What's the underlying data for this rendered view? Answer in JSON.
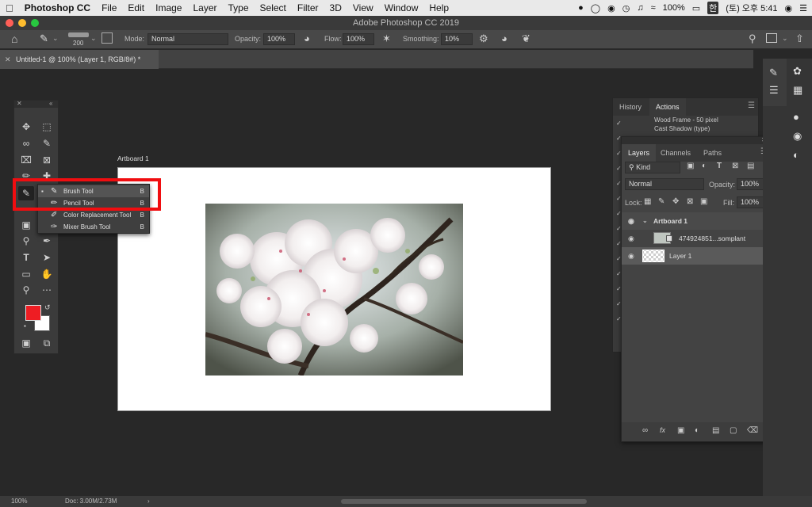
{
  "menubar": {
    "app_name": "Photoshop CC",
    "items": [
      "File",
      "Edit",
      "Image",
      "Layer",
      "Type",
      "Select",
      "Filter",
      "3D",
      "View",
      "Window",
      "Help"
    ],
    "battery": "100%",
    "input_method": "한",
    "clock": "(토) 오후 5:41"
  },
  "window": {
    "title": "Adobe Photoshop CC 2019"
  },
  "options": {
    "brush_size": "200",
    "mode_label": "Mode:",
    "mode_value": "Normal",
    "opacity_label": "Opacity:",
    "opacity_value": "100%",
    "flow_label": "Flow:",
    "flow_value": "100%",
    "smoothing_label": "Smoothing:",
    "smoothing_value": "10%"
  },
  "document": {
    "tab_title": "Untitled-1 @ 100% (Layer 1, RGB/8#) *",
    "artboard_label": "Artboard 1"
  },
  "flyout": {
    "items": [
      {
        "label": "Brush Tool",
        "key": "B"
      },
      {
        "label": "Pencil Tool",
        "key": "B"
      },
      {
        "label": "Color Replacement Tool",
        "key": "B"
      },
      {
        "label": "Mixer Brush Tool",
        "key": "B"
      }
    ]
  },
  "history_panel": {
    "tabs": [
      "History",
      "Actions"
    ],
    "rows": [
      "Wood Frame - 50 pixel",
      "Cast Shadow (type)"
    ]
  },
  "layers_panel": {
    "tabs": [
      "Layers",
      "Channels",
      "Paths"
    ],
    "kind_label": "Kind",
    "blend_mode": "Normal",
    "opacity_label": "Opacity:",
    "opacity_value": "100%",
    "lock_label": "Lock:",
    "fill_label": "Fill:",
    "fill_value": "100%",
    "layers": [
      {
        "name": "Artboard 1"
      },
      {
        "name": "474924851...somplant"
      },
      {
        "name": "Layer 1"
      }
    ]
  },
  "status": {
    "zoom": "100%",
    "doc": "Doc: 3.00M/2.73M"
  },
  "colors": {
    "foreground": "#ee1d23",
    "background": "#ffffff",
    "highlight": "#f00d10"
  }
}
